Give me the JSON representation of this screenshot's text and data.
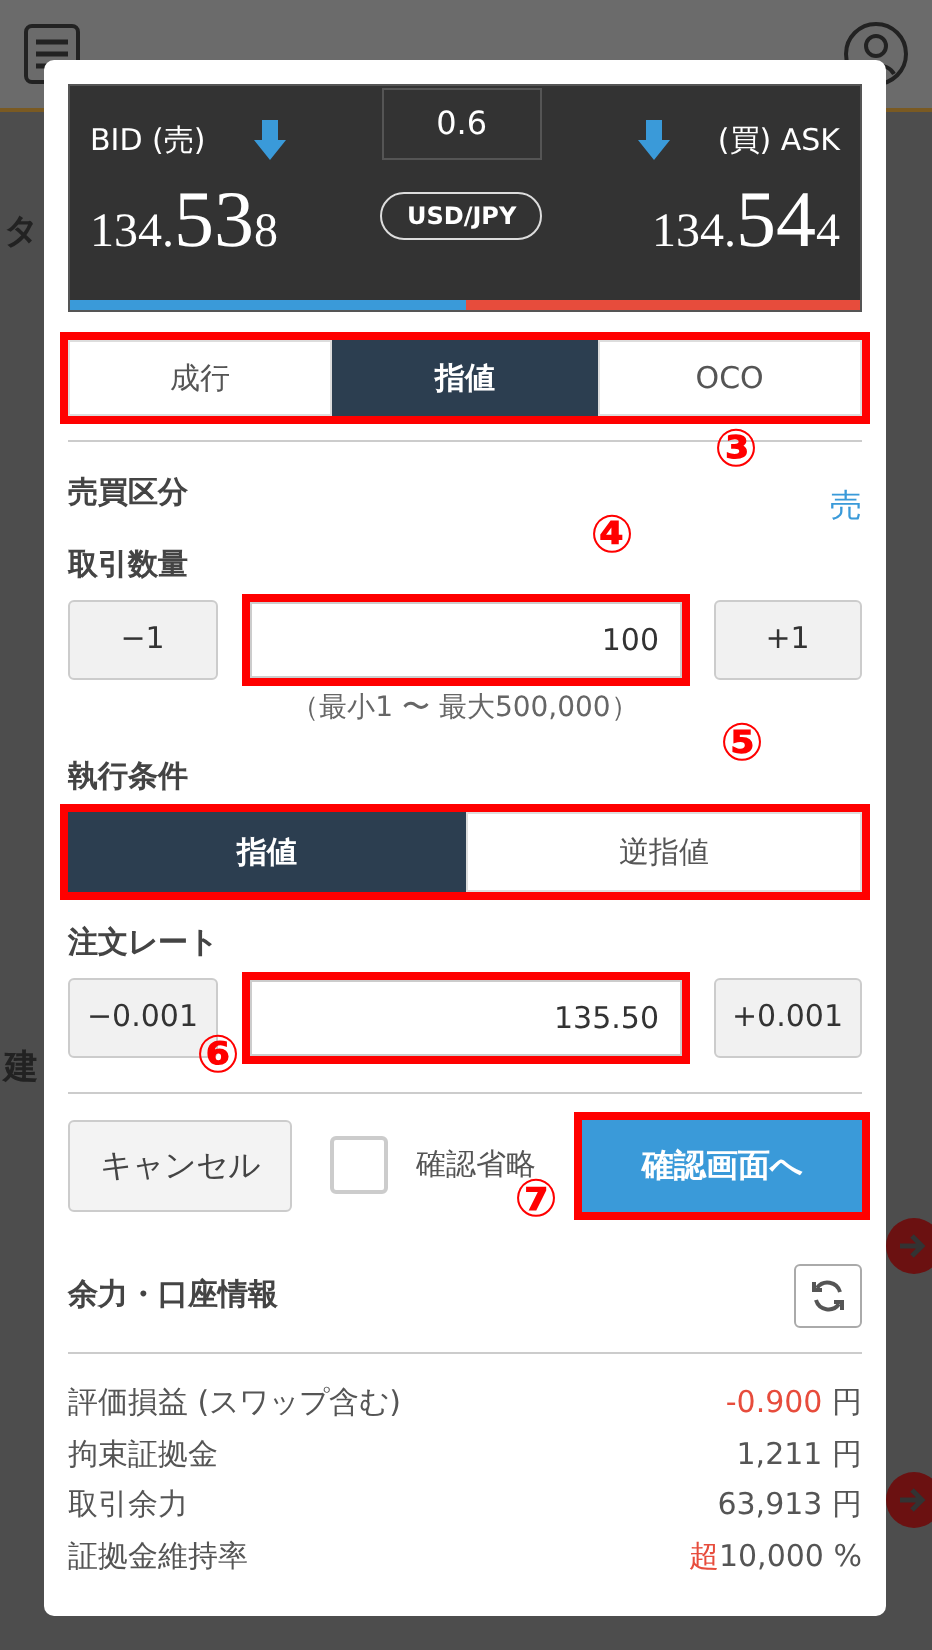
{
  "background": {
    "texts": [
      "タ",
      "建"
    ]
  },
  "quote": {
    "bid_label": "BID (売)",
    "ask_label": "(買) ASK",
    "spread": "0.6",
    "pair": "USD/JPY",
    "bid": [
      "134.",
      "53",
      "8"
    ],
    "ask": [
      "134.",
      "54",
      "4"
    ],
    "level": 0.5
  },
  "order_types": {
    "highlighted": true,
    "items": [
      {
        "label": "成行",
        "selected": false
      },
      {
        "label": "指値",
        "selected": true
      },
      {
        "label": "OCO",
        "selected": false
      }
    ]
  },
  "side": {
    "label": "売買区分",
    "value": "売"
  },
  "quantity": {
    "label": "取引数量",
    "minus": "−1",
    "value": "100",
    "plus": "+1",
    "hint": "（最小1 〜 最大500,000）",
    "highlighted": true
  },
  "execution": {
    "label": "執行条件",
    "highlighted": true,
    "items": [
      {
        "label": "指値",
        "selected": true
      },
      {
        "label": "逆指値",
        "selected": false
      }
    ]
  },
  "rate": {
    "label": "注文レート",
    "minus": "−0.001",
    "value": "135.50",
    "plus": "+0.001",
    "highlighted": true
  },
  "actions": {
    "cancel": "キャンセル",
    "skip_confirm": {
      "label": "確認省略",
      "checked": false
    },
    "confirm": "確認画面へ",
    "confirm_highlighted": true
  },
  "account": {
    "title": "余力・口座情報",
    "rows": [
      {
        "label": "評価損益 (スワップ含む)",
        "value": "-0.900",
        "unit": "円",
        "kind": "loss"
      },
      {
        "label": "拘束証拠金",
        "value": "1,211",
        "unit": "円",
        "kind": "plain"
      },
      {
        "label": "取引余力",
        "value": "63,913",
        "unit": "円",
        "kind": "plain"
      },
      {
        "label": "証拠金維持率",
        "prefix": "超",
        "value": "10,000",
        "unit": "%",
        "kind": "plain"
      }
    ]
  },
  "annotations": [
    {
      "label": "③"
    },
    {
      "label": "④"
    },
    {
      "label": "⑤"
    },
    {
      "label": "⑥"
    },
    {
      "label": "⑦"
    }
  ]
}
